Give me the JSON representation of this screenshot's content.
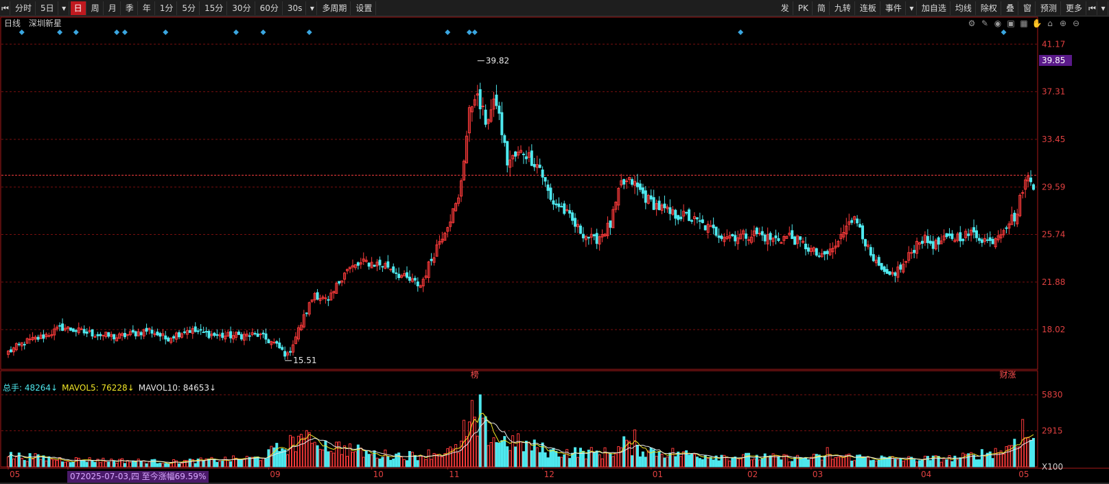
{
  "toolbar": {
    "left_buttons": [
      "分时",
      "5日",
      "日",
      "周",
      "月",
      "季",
      "年",
      "1分",
      "5分",
      "15分",
      "30分",
      "60分",
      "30s",
      "多周期",
      "设置"
    ],
    "active_index": 2,
    "right_buttons": [
      "发",
      "PK",
      "简",
      "九转",
      "连板",
      "事件",
      "加自选",
      "均线",
      "除权",
      "叠",
      "窗",
      "预测",
      "更多"
    ]
  },
  "header": {
    "period": "日线",
    "name": "深圳新星"
  },
  "colors": {
    "up": "#ff3b3b",
    "down": "#4ee8ee",
    "grid": "#7a0f0f",
    "axis": "#aa1a1a",
    "ma5": "#f2e626",
    "ma10": "#e8e8e8",
    "current_price_bg": "#5a1a8a"
  },
  "volume": {
    "total_label": "总手: 48264↓",
    "mavol5_label": "MAVOL5: 76228↓",
    "mavol10_label": "MAVOL10: 84653↓"
  },
  "range_tip": "072025-07-03,四 至今涨幅69.59%",
  "chart_data": {
    "type": "candlestick",
    "y_ticks": [
      18.02,
      21.88,
      25.74,
      29.59,
      33.45,
      37.31,
      41.17
    ],
    "ylim": [
      14.8,
      42.3
    ],
    "current_price": "39.85",
    "high_label": "39.82",
    "low_label": "15.51",
    "ref_line": 30.54,
    "volume_ticks": [
      "5830",
      "2915",
      "X100"
    ],
    "volume_max": 5830,
    "x_labels": [
      {
        "label": "05",
        "index": 0
      },
      {
        "label": "07",
        "index": 22
      },
      {
        "label": "09",
        "index": 96
      },
      {
        "label": "10",
        "index": 134
      },
      {
        "label": "11",
        "index": 162
      },
      {
        "label": "12",
        "index": 197
      },
      {
        "label": "01",
        "index": 237
      },
      {
        "label": "02",
        "index": 272
      },
      {
        "label": "03",
        "index": 296
      },
      {
        "label": "04",
        "index": 336
      },
      {
        "label": "05",
        "index": 372
      }
    ],
    "event_marks": [
      5,
      19,
      25,
      40,
      43,
      58,
      84,
      94,
      111,
      162,
      170,
      172,
      270,
      367
    ],
    "tags": [
      {
        "text": "榜",
        "index": 172
      },
      {
        "text": "财涨",
        "index": 367
      }
    ],
    "anchors": [
      [
        0,
        16.2
      ],
      [
        6,
        17.0
      ],
      [
        12,
        17.4
      ],
      [
        20,
        18.2
      ],
      [
        28,
        17.8
      ],
      [
        40,
        17.4
      ],
      [
        52,
        18.0
      ],
      [
        58,
        17.3
      ],
      [
        66,
        18.0
      ],
      [
        78,
        17.5
      ],
      [
        92,
        17.6
      ],
      [
        98,
        16.9
      ],
      [
        103,
        15.9
      ],
      [
        108,
        18.5
      ],
      [
        113,
        21.0
      ],
      [
        118,
        20.2
      ],
      [
        124,
        22.8
      ],
      [
        132,
        23.5
      ],
      [
        140,
        23.2
      ],
      [
        146,
        22.2
      ],
      [
        152,
        21.6
      ],
      [
        158,
        24.8
      ],
      [
        166,
        28.5
      ],
      [
        170,
        35.5
      ],
      [
        172,
        37.2
      ],
      [
        176,
        35.0
      ],
      [
        180,
        36.5
      ],
      [
        184,
        31.6
      ],
      [
        190,
        32.5
      ],
      [
        196,
        31.2
      ],
      [
        200,
        28.5
      ],
      [
        204,
        27.9
      ],
      [
        210,
        26.2
      ],
      [
        216,
        25.2
      ],
      [
        222,
        26.5
      ],
      [
        226,
        29.8
      ],
      [
        230,
        30.0
      ],
      [
        236,
        28.5
      ],
      [
        244,
        27.4
      ],
      [
        250,
        27.2
      ],
      [
        256,
        26.5
      ],
      [
        262,
        25.8
      ],
      [
        268,
        25.6
      ],
      [
        276,
        25.8
      ],
      [
        282,
        25.3
      ],
      [
        288,
        25.6
      ],
      [
        294,
        24.8
      ],
      [
        300,
        23.8
      ],
      [
        306,
        25.0
      ],
      [
        310,
        27.2
      ],
      [
        314,
        26.5
      ],
      [
        318,
        23.8
      ],
      [
        324,
        22.2
      ],
      [
        330,
        23.2
      ],
      [
        336,
        25.4
      ],
      [
        342,
        24.9
      ],
      [
        348,
        25.5
      ],
      [
        356,
        25.8
      ],
      [
        362,
        25.1
      ],
      [
        368,
        26.6
      ],
      [
        372,
        27.4
      ],
      [
        374,
        29.6
      ],
      [
        376,
        30.3
      ],
      [
        378,
        29.9
      ]
    ],
    "volume_anchors": [
      [
        0,
        900
      ],
      [
        20,
        600
      ],
      [
        60,
        400
      ],
      [
        92,
        700
      ],
      [
        108,
        2200
      ],
      [
        114,
        1800
      ],
      [
        124,
        1500
      ],
      [
        134,
        1000
      ],
      [
        150,
        900
      ],
      [
        165,
        1300
      ],
      [
        170,
        2600
      ],
      [
        174,
        3200
      ],
      [
        180,
        2200
      ],
      [
        190,
        1800
      ],
      [
        200,
        1200
      ],
      [
        220,
        1100
      ],
      [
        228,
        1600
      ],
      [
        236,
        1300
      ],
      [
        250,
        1000
      ],
      [
        270,
        800
      ],
      [
        290,
        700
      ],
      [
        310,
        800
      ],
      [
        330,
        600
      ],
      [
        350,
        700
      ],
      [
        368,
        1400
      ],
      [
        372,
        2500
      ],
      [
        378,
        2300
      ]
    ],
    "volume_spikes": [
      [
        108,
        1.7
      ],
      [
        113,
        1.6
      ],
      [
        116,
        1.3
      ],
      [
        168,
        1.5
      ],
      [
        171,
        1.9
      ],
      [
        174,
        1.6
      ],
      [
        227,
        1.5
      ],
      [
        231,
        1.4
      ],
      [
        302,
        1.8
      ],
      [
        374,
        1.3
      ]
    ]
  }
}
